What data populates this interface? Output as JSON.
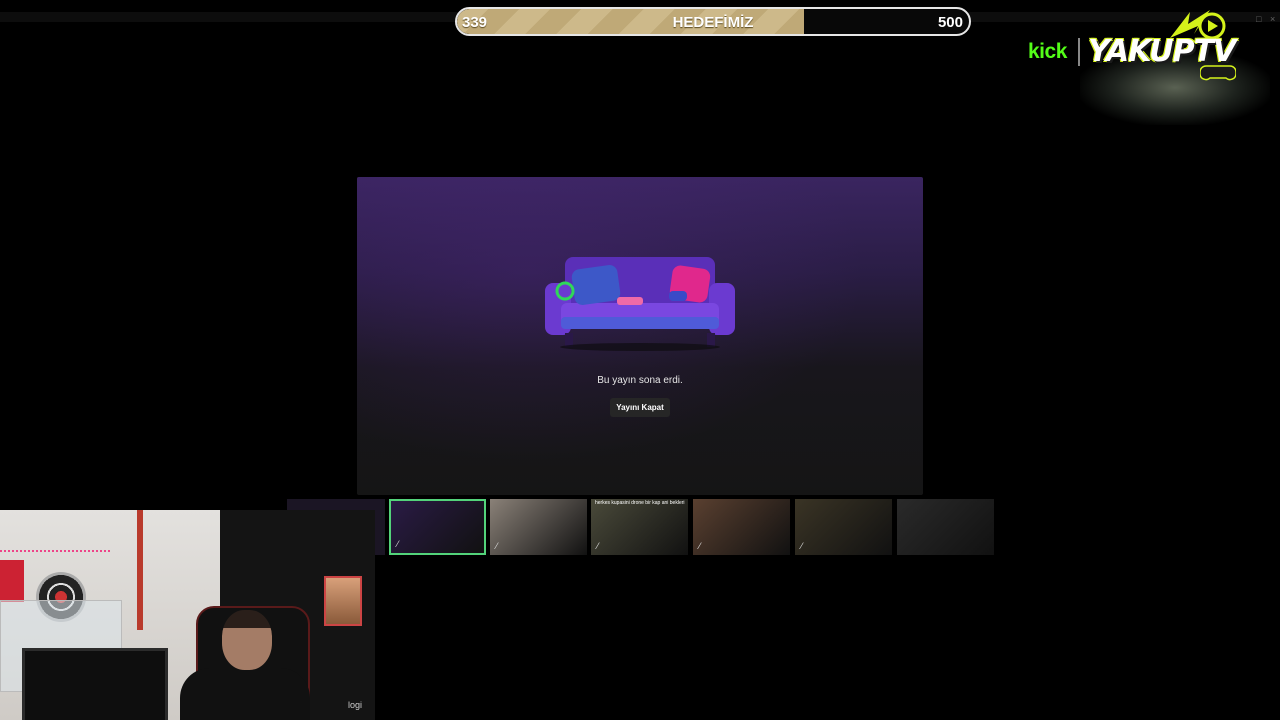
{
  "goal": {
    "start": "339",
    "title": "HEDEFİMİZ",
    "end": "500",
    "progress": 0.678,
    "fill_color": "#cdb98a"
  },
  "logo": {
    "kick": "kick",
    "brand": "YAKUPTV",
    "kick_color": "#53fc18",
    "accent_color": "#d4f21a"
  },
  "window": {
    "maximize_icon": "□",
    "close_icon": "×"
  },
  "stream_dialog": {
    "message": "Bu yayın sona erdi.",
    "button_label": "Yayını Kapat",
    "illustration": "purple-couch"
  },
  "thumbnails": {
    "items": [
      {
        "label": "",
        "active": true,
        "color": "#2a1b45"
      },
      {
        "label": "",
        "active": false,
        "color": "#8a8178"
      },
      {
        "label": "herkes kupasini drone bir kap ani bekleri",
        "active": false,
        "color": "#4a4a3a"
      },
      {
        "label": "",
        "active": false,
        "color": "#5a4030"
      },
      {
        "label": "",
        "active": false,
        "color": "#3a3425"
      },
      {
        "label": "",
        "active": false,
        "color": "#2a2a2a"
      }
    ],
    "mic_icon": "mic-muted-icon"
  },
  "webcam": {
    "brand_label": "logi"
  }
}
